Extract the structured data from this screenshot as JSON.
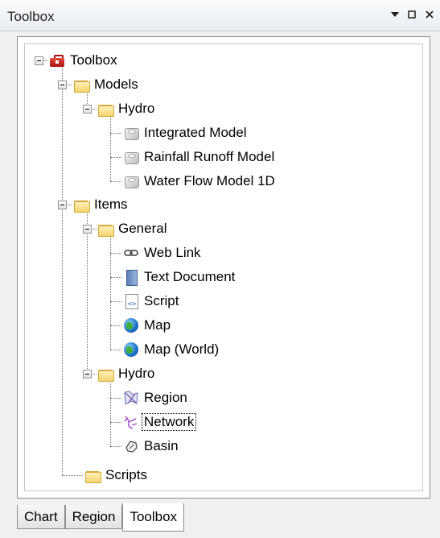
{
  "window": {
    "title": "Toolbox",
    "controls": [
      "dropdown-arrow",
      "maximize",
      "close"
    ]
  },
  "tree": {
    "root_label": "Toolbox",
    "models_label": "Models",
    "models_hydro_label": "Hydro",
    "models_hydro_children": [
      "Integrated Model",
      "Rainfall Runoff Model",
      "Water Flow Model 1D"
    ],
    "items_label": "Items",
    "general_label": "General",
    "general_children": [
      "Web Link",
      "Text Document",
      "Script",
      "Map",
      "Map (World)"
    ],
    "items_hydro_label": "Hydro",
    "items_hydro_children": [
      "Region",
      "Network",
      "Basin"
    ],
    "scripts_label": "Scripts",
    "selected": "Network"
  },
  "tabs": [
    "Chart",
    "Region",
    "Toolbox"
  ],
  "active_tab": "Toolbox",
  "icons": {
    "root": "toolbox-icon",
    "folder": "folder-icon",
    "model": "model-cube-icon",
    "web_link": "chain-link-icon",
    "text_document": "text-document-icon",
    "script": "script-icon",
    "map": "globe-icon",
    "region": "region-icon",
    "network": "network-icon",
    "basin": "basin-icon"
  }
}
